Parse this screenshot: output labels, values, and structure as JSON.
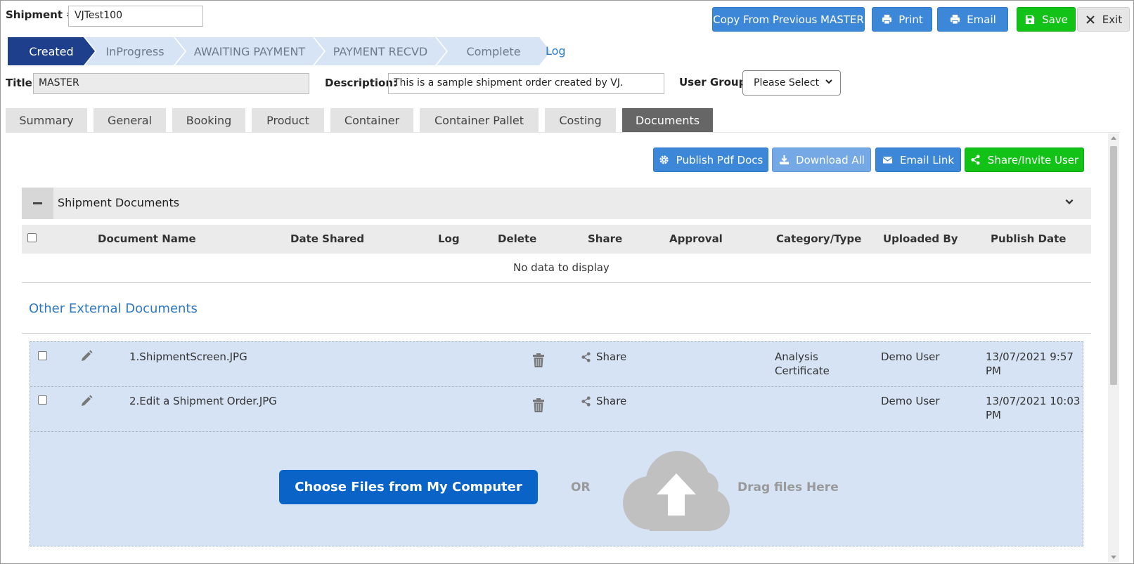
{
  "header": {
    "shipment_label": "Shipment #:",
    "shipment_value": "VJTest100",
    "buttons": {
      "copy": "Copy From Previous MASTER",
      "print": "Print",
      "email": "Email",
      "save": "Save",
      "exit": "Exit"
    }
  },
  "workflow": {
    "steps": [
      "Created",
      "InProgress",
      "AWAITING PAYMENT",
      "PAYMENT RECVD",
      "Complete"
    ],
    "active": "Created",
    "log_link": "Log"
  },
  "details": {
    "title_label": "Title:",
    "title_value": "MASTER",
    "description_label": "Description:",
    "description_value": "This is a sample shipment order created by VJ.",
    "user_group_label": "User Group:",
    "user_group_selected": "Please Select"
  },
  "tabs": [
    "Summary",
    "General",
    "Booking",
    "Product",
    "Container",
    "Container Pallet",
    "Costing",
    "Documents"
  ],
  "active_tab": "Documents",
  "actions": {
    "publish": "Publish Pdf Docs",
    "download": "Download All",
    "email_link": "Email Link",
    "share": "Share/Invite User"
  },
  "shipment_documents": {
    "title": "Shipment Documents",
    "columns": [
      "Document Name",
      "Date Shared",
      "Log",
      "Delete",
      "Share",
      "Approval",
      "Category/Type",
      "Uploaded By",
      "Publish Date"
    ],
    "empty_text": "No data to display"
  },
  "external_documents": {
    "title": "Other External Documents",
    "rows": [
      {
        "name": "1.ShipmentScreen.JPG",
        "share": "Share",
        "category_line1": "Analysis",
        "category_line2": "Certificate",
        "uploaded_by": "Demo User",
        "date_line1": "13/07/2021 9:57",
        "date_line2": "PM"
      },
      {
        "name": "2.Edit a Shipment Order.JPG",
        "share": "Share",
        "category_line1": "",
        "category_line2": "",
        "uploaded_by": "Demo User",
        "date_line1": "13/07/2021 10:03",
        "date_line2": "PM"
      }
    ],
    "upload_button": "Choose Files from My Computer",
    "or_text": "OR",
    "drag_text": "Drag files Here"
  },
  "colors": {
    "primary_blue": "#3d87d9",
    "green": "#12c217",
    "active_step": "#1d3f8c",
    "drop_zone": "#d6e3f5"
  }
}
